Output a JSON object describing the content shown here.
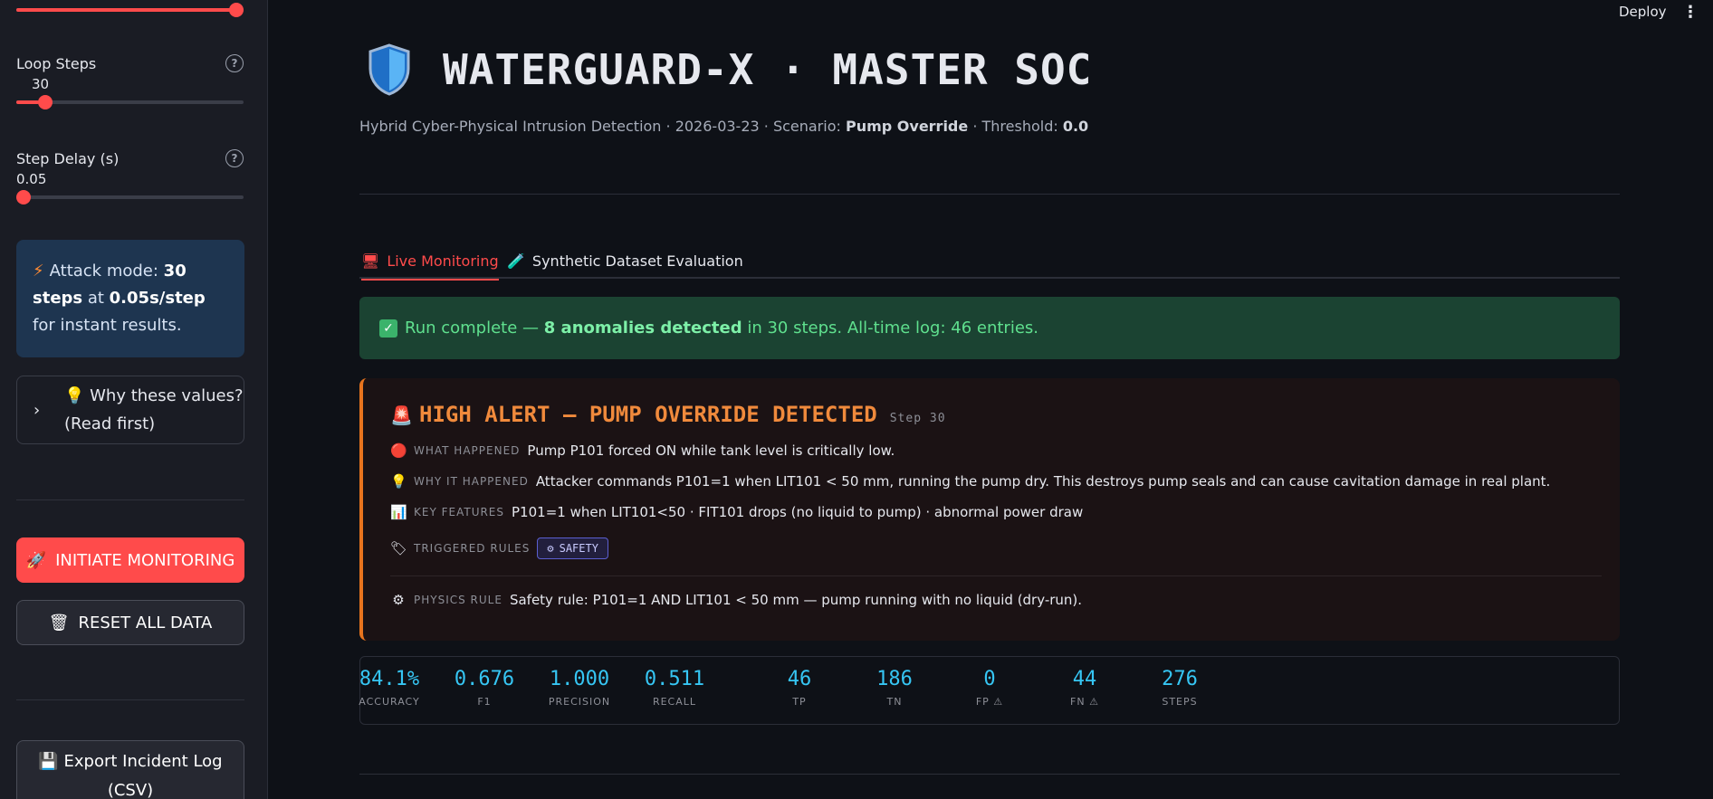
{
  "header": {
    "deploy_label": "Deploy",
    "menu_icon": "kebab-icon"
  },
  "sidebar": {
    "top_slider": {
      "fraction": 1.0
    },
    "loop_steps": {
      "label": "Loop Steps",
      "value": "30",
      "fraction": 0.1
    },
    "step_delay": {
      "label": "Step Delay (s)",
      "value": "0.05",
      "fraction": 0.0
    },
    "info": {
      "prefix": "Attack mode: ",
      "steps_bold": "30 steps",
      "mid": " at ",
      "rate_bold": "0.05s/step",
      "suffix": " for instant results."
    },
    "expander": {
      "line1": "💡 Why these values?",
      "line2": "(Read first)"
    },
    "initiate_label": "INITIATE MONITORING",
    "reset_label": "RESET ALL DATA",
    "export_line1": "Export Incident Log",
    "export_line2": "(CSV)"
  },
  "main": {
    "title": "WATERGUARD-X · MASTER SOC",
    "subtitle_prefix": "Hybrid Cyber-Physical Intrusion Detection · 2026-03-23 · Scenario: ",
    "scenario": "Pump Override",
    "threshold_prefix": " · Threshold: ",
    "threshold": "0.0",
    "tabs": [
      {
        "label": "Live Monitoring",
        "active": true
      },
      {
        "label": "Synthetic Dataset Evaluation",
        "active": false
      }
    ],
    "success": {
      "prefix": "Run complete — ",
      "bold": "8 anomalies detected",
      "suffix": " in 30 steps. All-time log: 46 entries."
    },
    "alert": {
      "title": "HIGH ALERT — PUMP OVERRIDE DETECTED",
      "step": "Step 30",
      "what_key": "WHAT HAPPENED",
      "what": "Pump P101 forced ON while tank level is critically low.",
      "why_key": "WHY IT HAPPENED",
      "why": "Attacker commands P101=1 when LIT101 < 50 mm, running the pump dry. This destroys pump seals and can cause cavitation damage in real plant.",
      "features_key": "KEY FEATURES",
      "features": "P101=1 when LIT101<50 · FIT101 drops (no liquid to pump) · abnormal power draw",
      "rules_key": "TRIGGERED RULES",
      "rule_tag": "SAFETY",
      "physics_key": "PHYSICS RULE",
      "physics": "Safety rule: P101=1 AND LIT101 < 50 mm — pump running with no liquid (dry-run)."
    },
    "metrics": [
      {
        "value": "84.1%",
        "label": "ACCURACY"
      },
      {
        "value": "0.676",
        "label": "F1"
      },
      {
        "value": "1.000",
        "label": "PRECISION"
      },
      {
        "value": "0.511",
        "label": "RECALL"
      },
      {
        "value": "46",
        "label": "TP"
      },
      {
        "value": "186",
        "label": "TN"
      },
      {
        "value": "0",
        "label": "FP ⚠"
      },
      {
        "value": "44",
        "label": "FN ⚠"
      },
      {
        "value": "276",
        "label": "STEPS"
      }
    ]
  },
  "colors": {
    "accent": "#ff4b4b",
    "metric": "#36c6f4",
    "alert": "#e8741e",
    "success_bg": "#1b4332"
  }
}
